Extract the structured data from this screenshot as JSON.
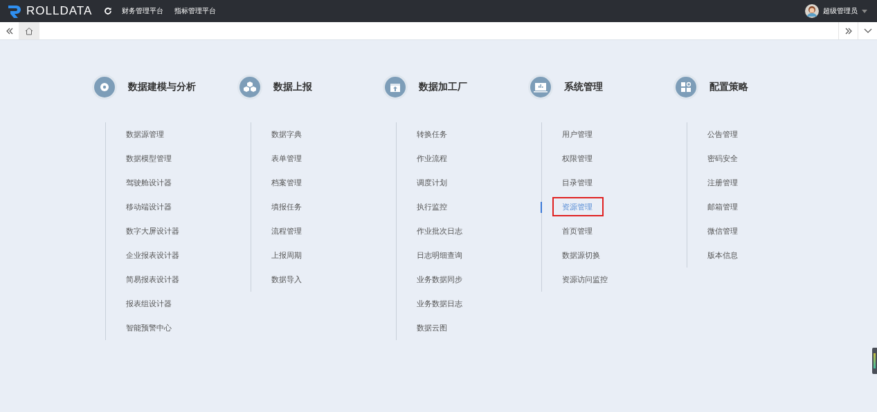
{
  "header": {
    "logo": "ROLLDATA",
    "nav": [
      "财务管理平台",
      "指标管理平台"
    ],
    "user": "超级管理员"
  },
  "groups": [
    {
      "title": "数据建模与分析",
      "items": [
        {
          "label": "数据源管理",
          "selected": false
        },
        {
          "label": "数据模型管理",
          "selected": false
        },
        {
          "label": "驾驶舱设计器",
          "selected": false
        },
        {
          "label": "移动端设计器",
          "selected": false
        },
        {
          "label": "数字大屏设计器",
          "selected": false
        },
        {
          "label": "企业报表设计器",
          "selected": false
        },
        {
          "label": "简易报表设计器",
          "selected": false
        },
        {
          "label": "报表组设计器",
          "selected": false
        },
        {
          "label": "智能预警中心",
          "selected": false
        }
      ]
    },
    {
      "title": "数据上报",
      "items": [
        {
          "label": "数据字典",
          "selected": false
        },
        {
          "label": "表单管理",
          "selected": false
        },
        {
          "label": "档案管理",
          "selected": false
        },
        {
          "label": "填报任务",
          "selected": false
        },
        {
          "label": "流程管理",
          "selected": false
        },
        {
          "label": "上报周期",
          "selected": false
        },
        {
          "label": "数据导入",
          "selected": false
        }
      ]
    },
    {
      "title": "数据加工厂",
      "items": [
        {
          "label": "转换任务",
          "selected": false
        },
        {
          "label": "作业流程",
          "selected": false
        },
        {
          "label": "调度计划",
          "selected": false
        },
        {
          "label": "执行监控",
          "selected": false
        },
        {
          "label": "作业批次日志",
          "selected": false
        },
        {
          "label": "日志明细查询",
          "selected": false
        },
        {
          "label": "业务数据同步",
          "selected": false
        },
        {
          "label": "业务数据日志",
          "selected": false
        },
        {
          "label": "数据云图",
          "selected": false
        }
      ]
    },
    {
      "title": "系统管理",
      "items": [
        {
          "label": "用户管理",
          "selected": false
        },
        {
          "label": "权限管理",
          "selected": false
        },
        {
          "label": "目录管理",
          "selected": false
        },
        {
          "label": "资源管理",
          "selected": true
        },
        {
          "label": "首页管理",
          "selected": false
        },
        {
          "label": "数据源切换",
          "selected": false
        },
        {
          "label": "资源访问监控",
          "selected": false
        }
      ]
    },
    {
      "title": "配置策略",
      "items": [
        {
          "label": "公告管理",
          "selected": false
        },
        {
          "label": "密码安全",
          "selected": false
        },
        {
          "label": "注册管理",
          "selected": false
        },
        {
          "label": "邮箱管理",
          "selected": false
        },
        {
          "label": "微信管理",
          "selected": false
        },
        {
          "label": "版本信息",
          "selected": false
        }
      ]
    }
  ]
}
